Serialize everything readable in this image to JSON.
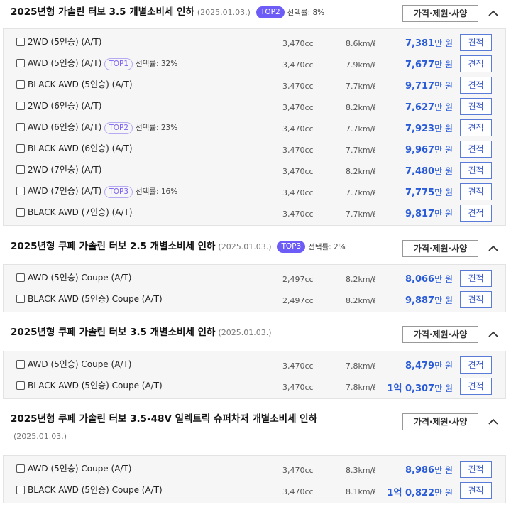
{
  "common": {
    "spec_button": "가격·제원·사양",
    "estimate_button": "견적"
  },
  "sections": [
    {
      "title": "2025년형 가솔린 터보 3.5 개별소비세 인하",
      "date": "(2025.01.03.)",
      "badge": "TOP2",
      "rate": "선택률: 8%",
      "rows": [
        {
          "name": "2WD (5인승) (A/T)",
          "badge": "",
          "rate": "",
          "cc": "3,470cc",
          "eff": "8.6km/ℓ",
          "price_pre": "",
          "price": "7,381",
          "unit": "만 원"
        },
        {
          "name": "AWD (5인승) (A/T)",
          "badge": "TOP1",
          "rate": "선택률: 32%",
          "cc": "3,470cc",
          "eff": "7.9km/ℓ",
          "price_pre": "",
          "price": "7,677",
          "unit": "만 원"
        },
        {
          "name": "BLACK AWD (5인승) (A/T)",
          "badge": "",
          "rate": "",
          "cc": "3,470cc",
          "eff": "7.7km/ℓ",
          "price_pre": "",
          "price": "9,717",
          "unit": "만 원"
        },
        {
          "name": "2WD (6인승) (A/T)",
          "badge": "",
          "rate": "",
          "cc": "3,470cc",
          "eff": "8.2km/ℓ",
          "price_pre": "",
          "price": "7,627",
          "unit": "만 원"
        },
        {
          "name": "AWD (6인승) (A/T)",
          "badge": "TOP2",
          "rate": "선택률: 23%",
          "cc": "3,470cc",
          "eff": "7.7km/ℓ",
          "price_pre": "",
          "price": "7,923",
          "unit": "만 원"
        },
        {
          "name": "BLACK AWD (6인승) (A/T)",
          "badge": "",
          "rate": "",
          "cc": "3,470cc",
          "eff": "7.7km/ℓ",
          "price_pre": "",
          "price": "9,967",
          "unit": "만 원"
        },
        {
          "name": "2WD (7인승) (A/T)",
          "badge": "",
          "rate": "",
          "cc": "3,470cc",
          "eff": "8.2km/ℓ",
          "price_pre": "",
          "price": "7,480",
          "unit": "만 원"
        },
        {
          "name": "AWD (7인승) (A/T)",
          "badge": "TOP3",
          "rate": "선택률: 16%",
          "cc": "3,470cc",
          "eff": "7.7km/ℓ",
          "price_pre": "",
          "price": "7,775",
          "unit": "만 원"
        },
        {
          "name": "BLACK AWD (7인승) (A/T)",
          "badge": "",
          "rate": "",
          "cc": "3,470cc",
          "eff": "7.7km/ℓ",
          "price_pre": "",
          "price": "9,817",
          "unit": "만 원"
        }
      ]
    },
    {
      "title": "2025년형 쿠페 가솔린 터보 2.5 개별소비세 인하",
      "date": "(2025.01.03.)",
      "badge": "TOP3",
      "rate": "선택률: 2%",
      "rows": [
        {
          "name": "AWD (5인승) Coupe (A/T)",
          "badge": "",
          "rate": "",
          "cc": "2,497cc",
          "eff": "8.2km/ℓ",
          "price_pre": "",
          "price": "8,066",
          "unit": "만 원"
        },
        {
          "name": "BLACK AWD (5인승) Coupe (A/T)",
          "badge": "",
          "rate": "",
          "cc": "2,497cc",
          "eff": "8.2km/ℓ",
          "price_pre": "",
          "price": "9,887",
          "unit": "만 원"
        }
      ]
    },
    {
      "title": "2025년형 쿠페 가솔린 터보 3.5 개별소비세 인하",
      "date": "(2025.01.03.)",
      "badge": "",
      "rate": "",
      "rows": [
        {
          "name": "AWD (5인승) Coupe (A/T)",
          "badge": "",
          "rate": "",
          "cc": "3,470cc",
          "eff": "7.8km/ℓ",
          "price_pre": "",
          "price": "8,479",
          "unit": "만 원"
        },
        {
          "name": "BLACK AWD (5인승) Coupe (A/T)",
          "badge": "",
          "rate": "",
          "cc": "3,470cc",
          "eff": "7.8km/ℓ",
          "price_pre": "1억",
          "price": "0,307",
          "unit": "만 원"
        }
      ]
    },
    {
      "title": "2025년형 쿠페 가솔린 터보 3.5-48V 일렉트릭 슈퍼차저 개별소비세 인하",
      "date": "(2025.01.03.)",
      "badge": "",
      "rate": "",
      "rows": [
        {
          "name": "AWD (5인승) Coupe (A/T)",
          "badge": "",
          "rate": "",
          "cc": "3,470cc",
          "eff": "8.3km/ℓ",
          "price_pre": "",
          "price": "8,986",
          "unit": "만 원"
        },
        {
          "name": "BLACK AWD (5인승) Coupe (A/T)",
          "badge": "",
          "rate": "",
          "cc": "3,470cc",
          "eff": "8.1km/ℓ",
          "price_pre": "1억",
          "price": "0,822",
          "unit": "만 원"
        }
      ]
    }
  ]
}
